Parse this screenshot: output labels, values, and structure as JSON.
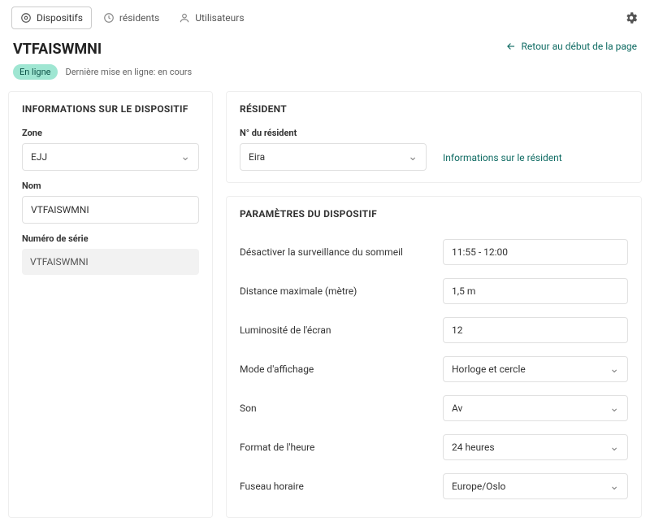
{
  "nav": {
    "devices": "Dispositifs",
    "residents": "résidents",
    "users": "Utilisateurs"
  },
  "header": {
    "title": "VTFAISWMNI",
    "backLabel": "Retour au début de la page",
    "status": "En ligne",
    "lastOnline": "Dernière mise en ligne: en cours"
  },
  "deviceInfo": {
    "title": "INFORMATIONS SUR LE DISPOSITIF",
    "zoneLabel": "Zone",
    "zoneValue": "EJJ",
    "nameLabel": "Nom",
    "nameValue": "VTFAISWMNI",
    "serialLabel": "Numéro de série",
    "serialValue": "VTFAISWMNI"
  },
  "resident": {
    "title": "RÉSIDENT",
    "numberLabel": "N° du résident",
    "value": "Eira",
    "infoLink": "Informations sur le résident"
  },
  "settings": {
    "title": "PARAMÈTRES DU DISPOSITIF",
    "rows": [
      {
        "label": "Désactiver la surveillance du sommeil",
        "value": "11:55 - 12:00",
        "type": "text"
      },
      {
        "label": "Distance maximale (mètre)",
        "value": "1,5 m",
        "type": "text"
      },
      {
        "label": "Luminosité de l'écran",
        "value": "12",
        "type": "text"
      },
      {
        "label": "Mode d'affichage",
        "value": "Horloge et cercle",
        "type": "select"
      },
      {
        "label": "Son",
        "value": "Av",
        "type": "select"
      },
      {
        "label": "Format de l'heure",
        "value": "24 heures",
        "type": "select"
      },
      {
        "label": "Fuseau horaire",
        "value": "Europe/Oslo",
        "type": "select"
      }
    ]
  }
}
